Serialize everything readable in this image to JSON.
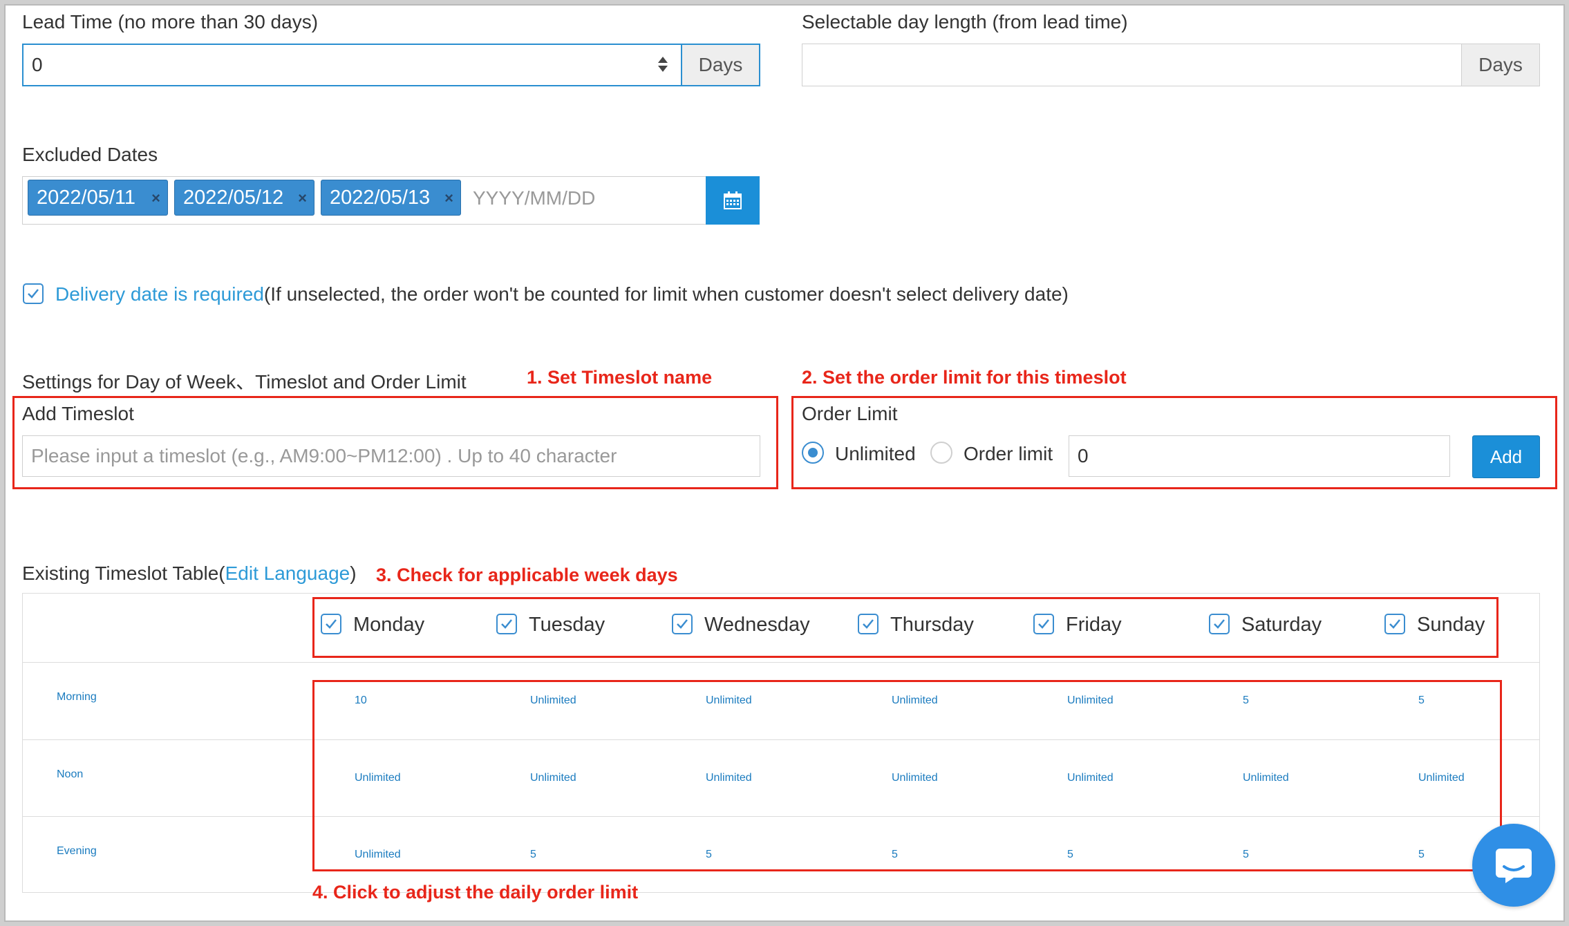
{
  "lead_time": {
    "label": "Lead Time (no more than 30 days)",
    "value": "0",
    "unit": "Days"
  },
  "selectable_days": {
    "label": "Selectable day length (from lead time)",
    "value": "",
    "unit": "Days"
  },
  "excluded_dates": {
    "label": "Excluded Dates",
    "tags": [
      "2022/05/11",
      "2022/05/12",
      "2022/05/13"
    ],
    "placeholder": "YYYY/MM/DD",
    "remove_glyph": "×",
    "calendar_icon": "calendar-icon"
  },
  "delivery_required": {
    "link_text": "Delivery date is required",
    "note": "(If unselected, the order won't be counted for limit when customer doesn't select delivery date)",
    "checked": true
  },
  "settings": {
    "title": "Settings for Day of Week、Timeslot and Order Limit",
    "add_timeslot_label": "Add Timeslot",
    "timeslot_placeholder": "Please input a timeslot (e.g., AM9:00~PM12:00) . Up to 40 character",
    "order_limit_label": "Order Limit",
    "unlimited_label": "Unlimited",
    "order_limit_option": "Order limit",
    "order_limit_value": "0",
    "add_button": "Add"
  },
  "annotations": {
    "step1": "1. Set Timeslot name",
    "step2": "2. Set the order limit for this timeslot",
    "step3": "3. Check for applicable week days",
    "step4": "4. Click to adjust the daily order limit",
    "color": "#e8261a"
  },
  "table": {
    "title_prefix": "Existing Timeslot Table(",
    "title_link": "Edit Language",
    "title_suffix": ")",
    "days": [
      "Monday",
      "Tuesday",
      "Wednesday",
      "Thursday",
      "Friday",
      "Saturday",
      "Sunday"
    ],
    "rows": [
      {
        "name": "Morning",
        "values": [
          "10",
          "Unlimited",
          "Unlimited",
          "Unlimited",
          "Unlimited",
          "5",
          "5"
        ]
      },
      {
        "name": "Noon",
        "values": [
          "Unlimited",
          "Unlimited",
          "Unlimited",
          "Unlimited",
          "Unlimited",
          "Unlimited",
          "Unlimited"
        ]
      },
      {
        "name": "Evening",
        "values": [
          "Unlimited",
          "5",
          "5",
          "5",
          "5",
          "5",
          "5"
        ]
      }
    ]
  },
  "colors": {
    "accent": "#1b8fd8",
    "link": "#2d9ad7",
    "cell_text": "#1a7bbf"
  },
  "chat_icon": "chat-bubble-icon"
}
